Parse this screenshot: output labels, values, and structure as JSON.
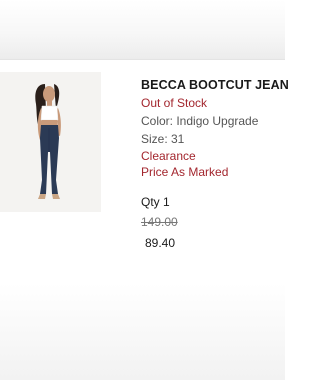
{
  "product": {
    "name": "BECCA BOOTCUT JEAN",
    "stock_status": "Out of Stock",
    "color_label": "Color: Indigo Upgrade",
    "size_label": "Size: 31",
    "clearance_label": "Clearance",
    "price_note": "Price As Marked",
    "quantity_label": "Qty 1",
    "original_price": "149.00",
    "sale_price": "89.40"
  },
  "colors": {
    "accent_red": "#a3262e",
    "denim": "#2b3a55"
  }
}
